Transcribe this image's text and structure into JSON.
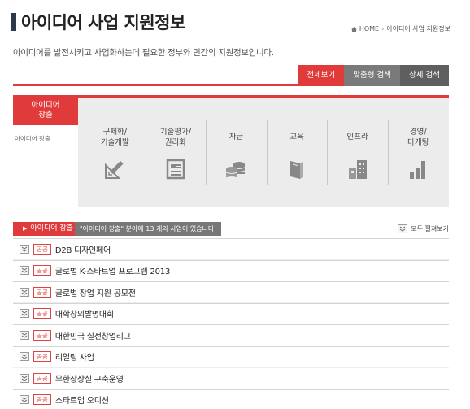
{
  "header": {
    "title": "아이디어 사업 지원정보",
    "subtitle": "아이디어를 발전시키고 사업화하는데 필요한 정부와 민간의 지원정보입니다.",
    "breadcrumb": {
      "home": "HOME",
      "separator": "›",
      "current": "아이디어 사업 지원정보"
    }
  },
  "tabs": [
    {
      "label": "전체보기",
      "active": true
    },
    {
      "label": "맞춤형 검색",
      "active": false
    },
    {
      "label": "상세 검색",
      "active": false
    }
  ],
  "category_panel": {
    "selected_tab": "아이디어\n창출",
    "selected_sub": "아이디어 창출",
    "items": [
      {
        "label": "구체화/\n기술개발",
        "icon": "ruler-pencil-icon"
      },
      {
        "label": "기술평가/\n권리화",
        "icon": "document-icon"
      },
      {
        "label": "자금",
        "icon": "coins-icon"
      },
      {
        "label": "교육",
        "icon": "book-icon"
      },
      {
        "label": "인프라",
        "icon": "buildings-icon"
      },
      {
        "label": "경영/\n마케팅",
        "icon": "bar-chart-icon"
      }
    ]
  },
  "filter": {
    "tag": "아이디어 창출",
    "message": "\"아이디어 창출\" 분야에 13 개의 사업이 있습니다.",
    "expand_all": "모두 펼쳐보기"
  },
  "list": {
    "badge": "공공",
    "items": [
      "D2B 디자인페어",
      "글로벌 K-스타트업 프로그램 2013",
      "글로벌 창업 지원 공모전",
      "대학창의발명대회",
      "대한민국 실전창업리그",
      "리얼링 사업",
      "무한상상실 구축운영",
      "스타트업 오디션"
    ]
  },
  "colors": {
    "accent": "#e03a3a",
    "tab_gray": "#6b6b6b",
    "panel_bg": "#ececec"
  }
}
